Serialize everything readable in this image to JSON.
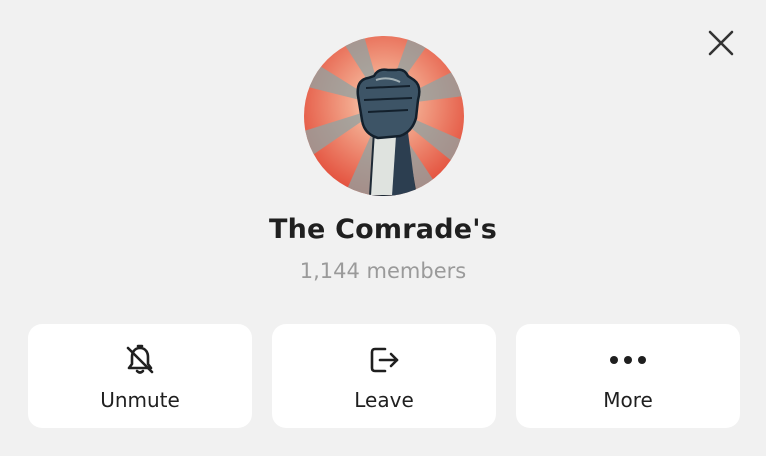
{
  "chat": {
    "title": "The Comrade's",
    "members": "1,144 members",
    "avatar_icon": "raised-fist-icon"
  },
  "actions": [
    {
      "label": "Unmute",
      "icon": "bell-slash-icon"
    },
    {
      "label": "Leave",
      "icon": "leave-icon"
    },
    {
      "label": "More",
      "icon": "more-dots-icon"
    }
  ],
  "controls": {
    "close_icon": "close-icon"
  },
  "colors": {
    "background": "#f1f1f1",
    "card": "#ffffff",
    "text": "#1f1f1f",
    "muted": "#9a9a9a",
    "avatar_red": "#e35a45"
  }
}
